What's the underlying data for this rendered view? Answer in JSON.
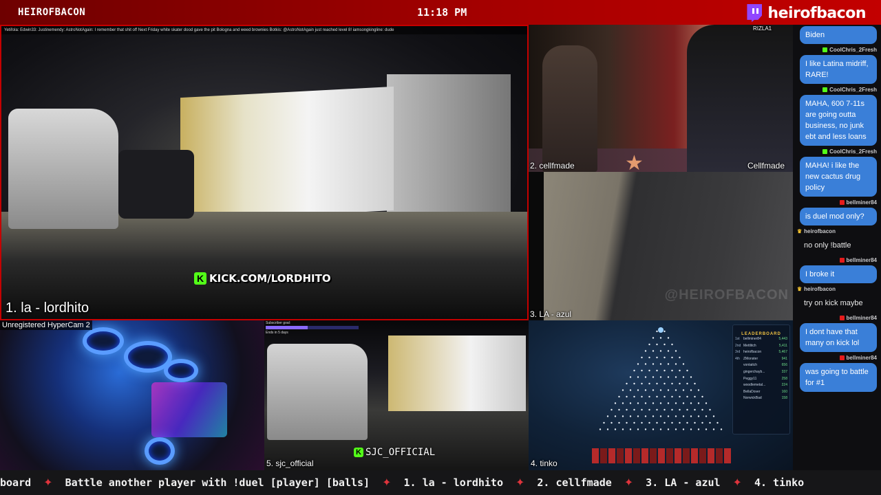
{
  "topbar": {
    "channel": "HEIROFBACON",
    "time": "11:18 PM",
    "brand": "heirofbacon"
  },
  "main": {
    "label": "1. la - lordhito",
    "overlay": "KICK.COM/LORDHITO",
    "chat_strip": "Yetiřola:  Edwin33:  Justinemendy:  AstroNotAgain: I remember that shit off Next Friday white skater dood gave the pit Bologna and weed brownies   Botkis: @AstroNotAgain just reached level 8!   iamsongkingline: dude"
  },
  "panels": {
    "top_right": {
      "label": "2. cellfmade",
      "tag": "Cellfmade",
      "top_tag": "RIZLA1"
    },
    "mid_right": {
      "label": "3. LA - azul",
      "watermark": "@HEIROFBACON"
    },
    "bottom_left": {
      "header": "Unregistered HyperCam 2"
    },
    "bottom_mid": {
      "label": "5. sjc_official",
      "overlay": "SJC_OFFICIAL",
      "goal_title": "Subscriber goal:",
      "goal_sub": "Ends in 5 days",
      "goal_progress": 0.45
    },
    "bottom_right": {
      "label": "4. tinko"
    }
  },
  "leaderboard": {
    "title": "LEADERBOARD",
    "rows": [
      {
        "rank": "1st",
        "name": "bellminer84",
        "score": "5,443"
      },
      {
        "rank": "2nd",
        "name": "Mettlitch",
        "score": "5,411"
      },
      {
        "rank": "3rd",
        "name": "heirofbacon",
        "score": "5,467"
      },
      {
        "rank": "4th",
        "name": "ZMonster",
        "score": "941"
      },
      {
        "rank": "",
        "name": "vontaitch",
        "score": "656"
      },
      {
        "rank": "",
        "name": "gingerchayb...",
        "score": "337"
      },
      {
        "rank": "",
        "name": "Peggy11",
        "score": "258"
      },
      {
        "rank": "",
        "name": "woodlemetal...",
        "score": "224"
      },
      {
        "rank": "",
        "name": "BellaDover",
        "score": "160"
      },
      {
        "rank": "",
        "name": "NorwickBad",
        "score": "158"
      }
    ]
  },
  "chat": {
    "items": [
      {
        "type": "bubble",
        "style": "blue",
        "text": "Biden"
      },
      {
        "type": "user",
        "badge": "kick",
        "name": "CoolChris_2Fresh",
        "align": "right"
      },
      {
        "type": "bubble",
        "style": "blue",
        "text": "I like Latina midriff, RARE!"
      },
      {
        "type": "user",
        "badge": "kick",
        "name": "CoolChris_2Fresh",
        "align": "right"
      },
      {
        "type": "bubble",
        "style": "blue",
        "text": "MAHA, 600 7-11s are going outta business, no junk ebt and less loans"
      },
      {
        "type": "user",
        "badge": "kick",
        "name": "CoolChris_2Fresh",
        "align": "right"
      },
      {
        "type": "bubble",
        "style": "blue",
        "text": "MAHA! i like the new cactus drug policy"
      },
      {
        "type": "user",
        "badge": "twitch",
        "name": "bellminer84",
        "align": "right"
      },
      {
        "type": "bubble",
        "style": "blue",
        "text": "is duel mod only?"
      },
      {
        "type": "user",
        "badge": "crown",
        "name": "heirofbacon",
        "align": "left"
      },
      {
        "type": "bubble",
        "style": "dark",
        "text": "no only !battle"
      },
      {
        "type": "user",
        "badge": "twitch",
        "name": "bellminer84",
        "align": "right"
      },
      {
        "type": "bubble",
        "style": "blue",
        "text": "I broke it"
      },
      {
        "type": "user",
        "badge": "crown",
        "name": "heirofbacon",
        "align": "left"
      },
      {
        "type": "bubble",
        "style": "dark",
        "text": "try on kick maybe"
      },
      {
        "type": "user",
        "badge": "twitch",
        "name": "bellminer84",
        "align": "right"
      },
      {
        "type": "bubble",
        "style": "blue",
        "text": "I dont have that many on kick lol"
      },
      {
        "type": "user",
        "badge": "twitch",
        "name": "bellminer84",
        "align": "right"
      },
      {
        "type": "bubble",
        "style": "blue",
        "text": "was going to battle for #1"
      }
    ]
  },
  "ticker": {
    "items": [
      "board",
      "Battle another player with !duel [player] [balls]",
      "1. la - lordhito",
      "2. cellfmade",
      "3. LA - azul",
      "4. tinko"
    ],
    "separator": "✦"
  },
  "colors": {
    "accent_red": "#c50000",
    "chat_bubble": "#3a7fd8",
    "kick_green": "#53fc18",
    "twitch_purple": "#9146ff"
  }
}
